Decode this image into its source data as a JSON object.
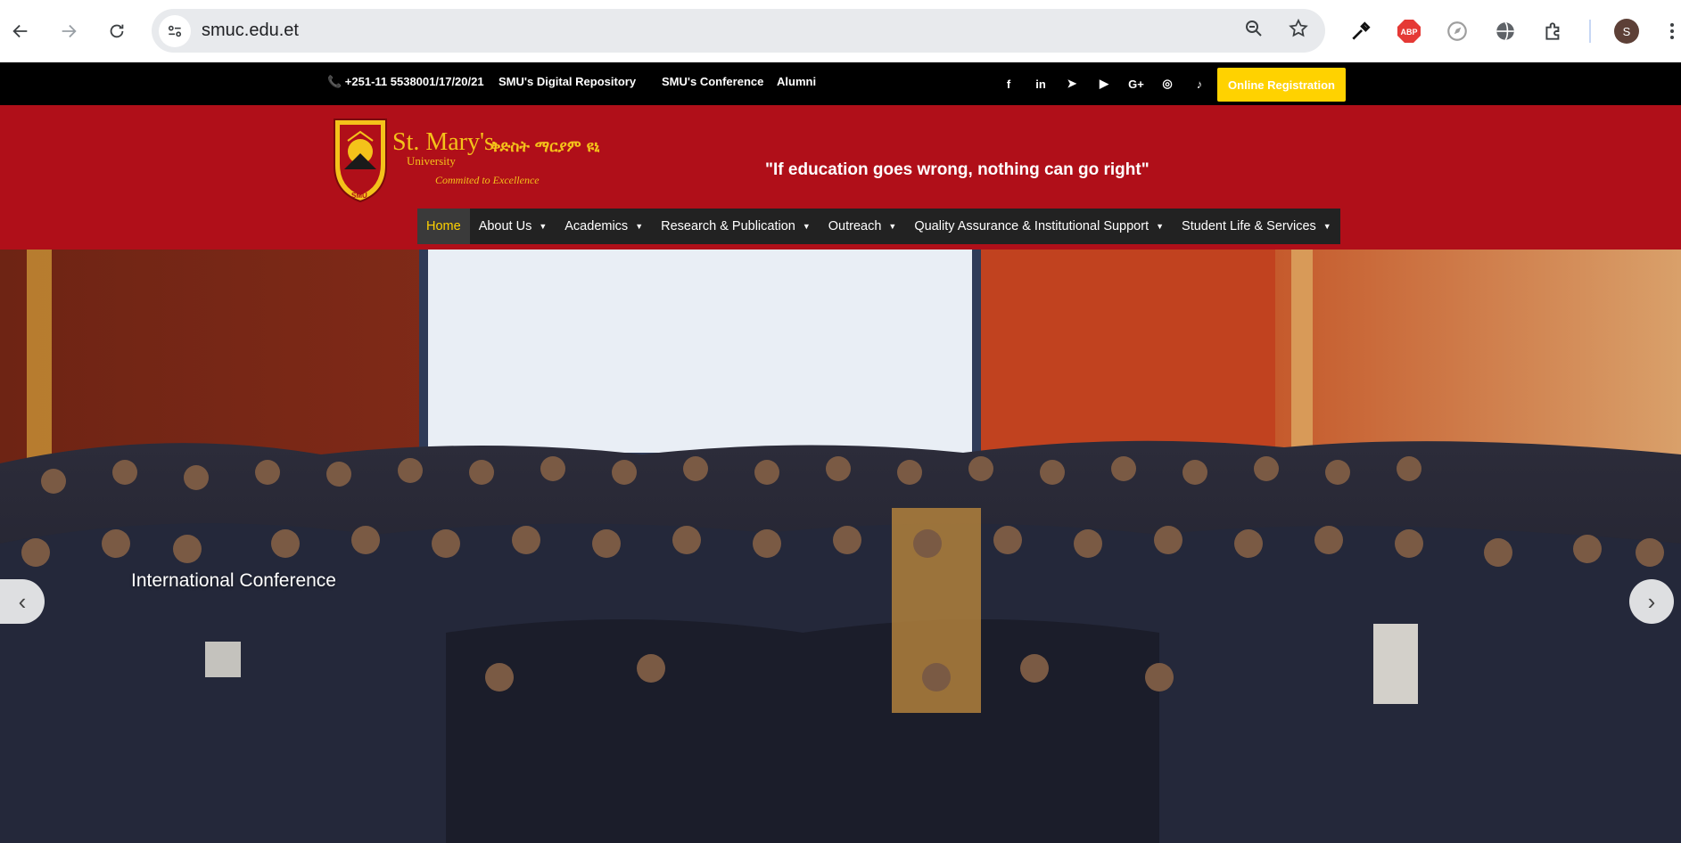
{
  "browser": {
    "url": "smuc.edu.et",
    "profile_initial": "S",
    "adblock_label": "ABP"
  },
  "topbar": {
    "phone": "📞 +251-11 5538001/17/20/21",
    "links": [
      "SMU's Digital Repository",
      "SMU's Conference",
      "Alumni"
    ],
    "social": [
      "f",
      "in",
      "➤",
      "▶",
      "G+",
      "◎",
      "♪"
    ],
    "register_label": "Online Registration"
  },
  "header": {
    "logo_en": "St. Mary's",
    "logo_sub": "University",
    "logo_am": "ቅድስት ማርያም ዩኒቨርስቲ",
    "logo_motto": "Commited to Excellence",
    "logo_abbr": "SMU",
    "tagline": "\"If education goes wrong, nothing can go right\""
  },
  "menu": [
    {
      "label": "Home",
      "active": true
    },
    {
      "label": "About Us"
    },
    {
      "label": "Academics"
    },
    {
      "label": "Research & Publication"
    },
    {
      "label": "Outreach"
    },
    {
      "label": "Quality Assurance & Institutional Support"
    },
    {
      "label": "Student Life & Services"
    }
  ],
  "hero": {
    "caption": "International Conference",
    "prev": "‹",
    "next": "›"
  },
  "colors": {
    "header_red": "#b00f19",
    "accent_yellow": "#ffd200",
    "menu_dark": "#222222"
  }
}
